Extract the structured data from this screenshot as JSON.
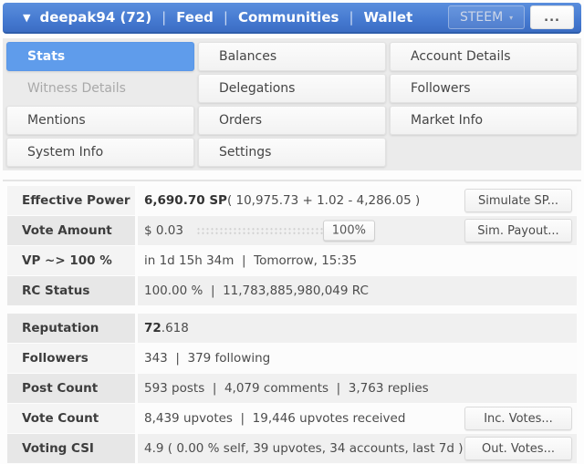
{
  "colors": {
    "header_blue_top": "#5a8edd",
    "header_blue_bottom": "#3b6dc3",
    "active_tab_blue": "#5f9ceb",
    "tabs_background": "#ebebeb",
    "stripe_gray": "#e7e7e7",
    "stripe_light": "#f4f4f4"
  },
  "header": {
    "caret_icon": "▼",
    "username": "deepak94 (72)",
    "sep": "|",
    "nav": [
      "Feed",
      "Communities",
      "Wallet"
    ],
    "steem_button": {
      "label": "STEEM",
      "caret": "▾"
    },
    "more_button": "..."
  },
  "tabs": [
    {
      "label": "Stats",
      "state": "active"
    },
    {
      "label": "Balances",
      "state": "normal"
    },
    {
      "label": "Account Details",
      "state": "normal"
    },
    {
      "label": "Witness Details",
      "state": "disabled"
    },
    {
      "label": "Delegations",
      "state": "normal"
    },
    {
      "label": "Followers",
      "state": "normal"
    },
    {
      "label": "Mentions",
      "state": "normal"
    },
    {
      "label": "Orders",
      "state": "normal"
    },
    {
      "label": "Market Info",
      "state": "normal"
    },
    {
      "label": "System Info",
      "state": "normal"
    },
    {
      "label": "Settings",
      "state": "normal"
    }
  ],
  "stats_primary": {
    "effective_power": {
      "label": "Effective Power",
      "value": "6,690.70 SP",
      "detail": " ( 10,975.73 + 1.02 - 4,286.05 )",
      "button": "Simulate SP..."
    },
    "vote_amount": {
      "label": "Vote Amount",
      "value": "$ 0.03",
      "slider_value": "100%",
      "button": "Sim. Payout..."
    },
    "vp_recharge": {
      "label": "VP ~> 100 %",
      "value": "in 1d 15h 34m  |  Tomorrow, 15:35"
    },
    "rc_status": {
      "label": "RC Status",
      "value": "100.00 %  |  11,783,885,980,049 RC"
    }
  },
  "stats_secondary": {
    "reputation": {
      "label": "Reputation",
      "value": "72",
      "detail": ".618"
    },
    "followers": {
      "label": "Followers",
      "value": "343  |  379 following"
    },
    "post_count": {
      "label": "Post Count",
      "value": "593 posts  |  4,079 comments  |  3,763 replies"
    },
    "vote_count": {
      "label": "Vote Count",
      "value": "8,439 upvotes  |  19,446 upvotes received",
      "button": "Inc. Votes..."
    },
    "voting_csi": {
      "label": "Voting CSI",
      "value": "4.9 ( 0.00 % self, 39 upvotes, 34 accounts, last 7d )",
      "button": "Out. Votes..."
    }
  }
}
